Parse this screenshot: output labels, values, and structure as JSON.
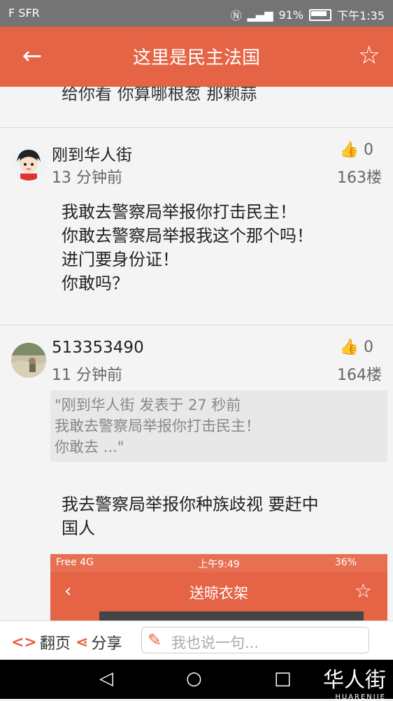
{
  "status_bar": {
    "carrier": "F SFR",
    "battery": "91%",
    "time": "下午1:35"
  },
  "header": {
    "title": "这里是民主法国",
    "back_icon": "←",
    "star_icon": "☆"
  },
  "cut_text": "给你看 你算哪根葱 那颗蒜",
  "posts": [
    {
      "username": "刚到华人街",
      "device_icon": "apple-icon",
      "time": "13 分钟前",
      "likes": "0",
      "floor": "163楼",
      "lines": [
        "我敢去警察局举报你打击民主！",
        "你敢去警察局举报我这个那个吗！",
        "进门要身份证！",
        "你敢吗？"
      ]
    },
    {
      "username": "513353490",
      "device_icon": "apple-icon",
      "time": "11 分钟前",
      "likes": "0",
      "floor": "164楼",
      "quote_lines": [
        "\"刚到华人街 发表于 27 秒前",
        "我敢去警察局举报你打击民主！",
        "你敢去 ...\""
      ],
      "lines": [
        "我去警察局举报你种族歧视 要赶中",
        "国人"
      ],
      "embedded_screenshot": {
        "signal": "Free  4G",
        "time": "上午9:49",
        "battery": "36%",
        "title": "送晾衣架"
      }
    }
  ],
  "bottom_bar": {
    "page_label": "翻页",
    "share_label": "分享",
    "reply_placeholder": "我也说一句..."
  },
  "watermark": {
    "cn": "华人街",
    "en": "HUARENJIE"
  },
  "colors": {
    "accent": "#e66446",
    "status_bar": "#747474"
  }
}
